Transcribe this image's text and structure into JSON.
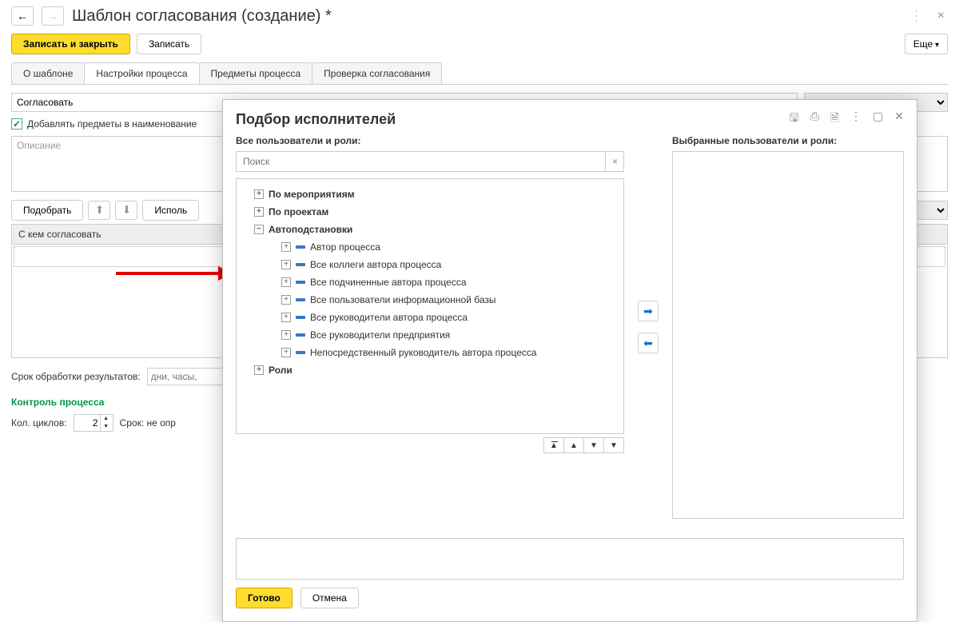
{
  "main": {
    "title": "Шаблон согласования (создание) *",
    "saveAndClose": "Записать и закрыть",
    "save": "Записать",
    "more": "Еще",
    "tabs": [
      "О шаблоне",
      "Настройки процесса",
      "Предметы процесса",
      "Проверка согласования"
    ],
    "agreeValue": "Согласовать",
    "addItemsCheckbox": "Добавлять предметы в наименование",
    "descriptionPlaceholder": "Описание",
    "pickBtn": "Подобрать",
    "useBtn": "Исполь",
    "tableHeader": "С кем согласовать",
    "deadlineLabel": "Срок обработки результатов:",
    "deadlinePlaceholder": "дни, часы,",
    "controlTitle": "Контроль процесса",
    "cyclesLabel": "Кол. циклов:",
    "cyclesValue": "2",
    "termLabel": "Срок: не опр"
  },
  "dialog": {
    "title": "Подбор исполнителей",
    "allLabel": "Все пользователи и роли:",
    "selectedLabel": "Выбранные пользователи и роли:",
    "searchPlaceholder": "Поиск",
    "tree": {
      "byEvents": "По мероприятиям",
      "byProjects": "По проектам",
      "autoSubst": "Автоподстановки",
      "children": [
        "Автор процесса",
        "Все коллеги автора процесса",
        "Все подчиненные автора процесса",
        "Все пользователи информационной базы",
        "Все руководители автора процесса",
        "Все руководители предприятия",
        "Непосредственный руководитель автора процесса"
      ],
      "roles": "Роли"
    },
    "done": "Готово",
    "cancel": "Отмена"
  }
}
